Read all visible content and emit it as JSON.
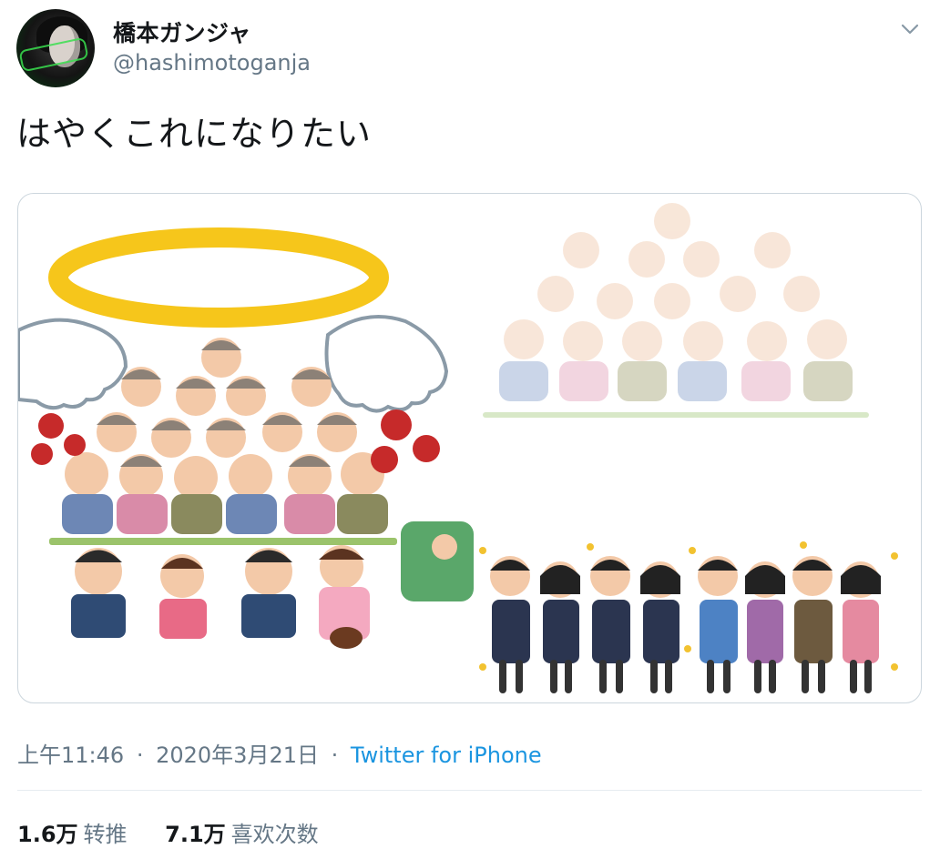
{
  "user": {
    "display_name": "橋本ガンジャ",
    "handle": "@hashimotoganja"
  },
  "header": {
    "menu_icon": "chevron-down-icon"
  },
  "tweet": {
    "text": "はやくこれになりたい"
  },
  "meta": {
    "time": "上午11:46",
    "date": "2020年3月21日",
    "separator": "·",
    "source": "Twitter for iPhone"
  },
  "stats": {
    "retweets_count": "1.6万",
    "retweets_label": "转推",
    "likes_count": "7.1万",
    "likes_label": "喜欢次数"
  },
  "colors": {
    "text": "#14171a",
    "secondary": "#657786",
    "link": "#1b95e0",
    "border": "#ccd6dd",
    "halo": "#f6c61b"
  }
}
